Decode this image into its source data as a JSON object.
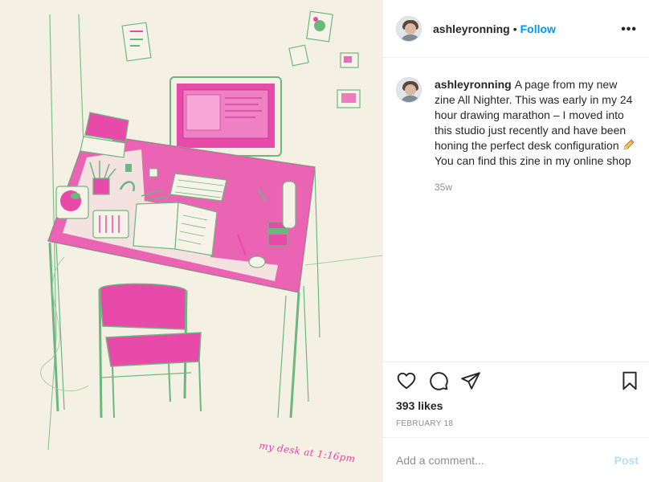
{
  "media": {
    "handwritten_caption": "my desk at 1:16pm",
    "palette": {
      "paper": "#f4f0e4",
      "pink": "#e84aa9",
      "green": "#6bb77e",
      "grey": "#c9c6bd"
    }
  },
  "header": {
    "username": "ashleyronning",
    "separator": "•",
    "follow_label": "Follow",
    "more_label": "•••"
  },
  "caption": {
    "username": "ashleyronning",
    "text_before_emoji": "A page from my new zine All Nighter. This was early in my 24 hour drawing marathon – I moved into this studio just recently and have been honing the perfect desk configuration",
    "emoji_icon": "pencil-icon",
    "text_after_emoji": " You can find this zine in my online shop",
    "time_ago": "35w"
  },
  "actions": {
    "icons": [
      "heart-icon",
      "comment-icon",
      "share-icon",
      "bookmark-icon"
    ],
    "likes": "393 likes",
    "date": "FEBRUARY 18"
  },
  "add_comment": {
    "placeholder": "Add a comment...",
    "post_label": "Post",
    "post_color": "#b2dffc"
  },
  "colors": {
    "link": "#0095f6",
    "text": "#262626",
    "muted": "#8e8e8e",
    "divider": "#efefef"
  }
}
